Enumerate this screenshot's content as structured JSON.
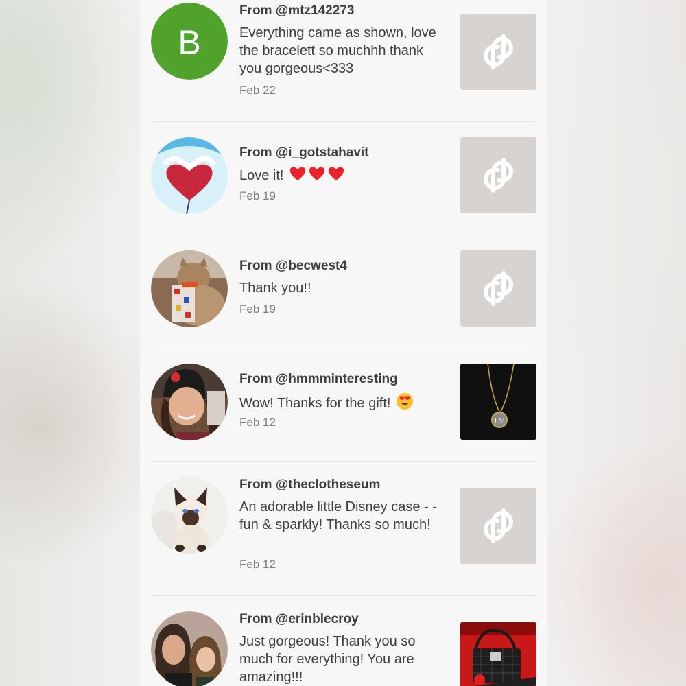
{
  "reviews": [
    {
      "from": "From @mtz142273",
      "message": "Everything came as shown, love the bracelett so muchhh thank you gorgeous<333",
      "date": "Feb 22",
      "avatar_letter": "B",
      "avatar_color": "#4fa22c",
      "thumbnail": "poshmark-placeholder-icon"
    },
    {
      "from": "From @i_gotstahavit",
      "message": "Love it!",
      "emoji": "red-heart x3",
      "date": "Feb 19",
      "thumbnail": "poshmark-placeholder-icon"
    },
    {
      "from": "From @becwest4",
      "message": "Thank you!!",
      "date": "Feb 19",
      "thumbnail": "poshmark-placeholder-icon"
    },
    {
      "from": "From @hmmminteresting",
      "message": "Wow! Thanks for the gift!",
      "emoji": "heart-eyes",
      "date": "Feb 12",
      "thumbnail": "necklace-photo"
    },
    {
      "from": "From @theclotheseum",
      "message": "An adorable little Disney case - - fun & sparkly! Thanks so much!",
      "date": "Feb 12",
      "thumbnail": "poshmark-placeholder-icon"
    },
    {
      "from": "From @erinblecroy",
      "message": "Just gorgeous! Thank you so much for everything! You are amazing!!!",
      "date": "",
      "thumbnail": "handbag-photo"
    }
  ],
  "colors": {
    "panel_bg": "#f8f7f8",
    "placeholder_bg": "#d7d3d1",
    "text": "#3f3e3f",
    "date_text": "#7c7b7d",
    "divider": "#e4e2e3"
  }
}
